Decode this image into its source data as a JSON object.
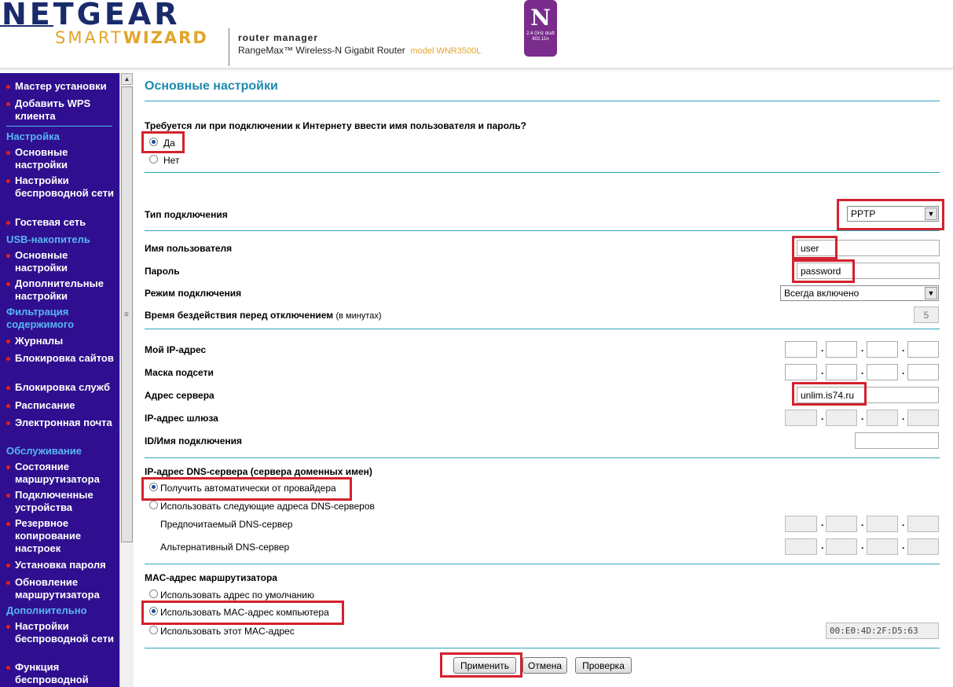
{
  "header": {
    "brand": "NETGEAR",
    "brand_sub_a": "SMART",
    "brand_sub_b": "WIZARD",
    "tagline": "router manager",
    "device": "RangeMax™ Wireless-N Gigabit Router",
    "model": "model WNR3500L",
    "badge_letter": "N",
    "badge_small": "2.4 GHz draft 802.11n"
  },
  "sidebar": {
    "items": [
      {
        "kind": "item",
        "label": "Мастер установки"
      },
      {
        "kind": "item",
        "label": "Добавить WPS клиента"
      },
      {
        "kind": "head",
        "label": "Настройка"
      },
      {
        "kind": "item",
        "label": "Основные настройки"
      },
      {
        "kind": "item",
        "label": "Настройки беспроводной сети"
      },
      {
        "kind": "item",
        "label": "Гостевая сеть"
      },
      {
        "kind": "head",
        "label": "USB-накопитель"
      },
      {
        "kind": "item",
        "label": "Основные настройки"
      },
      {
        "kind": "item",
        "label": "Дополнительные настройки"
      },
      {
        "kind": "head",
        "label": "Фильтрация содержимого"
      },
      {
        "kind": "item",
        "label": "Журналы"
      },
      {
        "kind": "item",
        "label": "Блокировка сайтов"
      },
      {
        "kind": "item",
        "label": "Блокировка служб"
      },
      {
        "kind": "item",
        "label": "Расписание"
      },
      {
        "kind": "item",
        "label": "Электронная почта"
      },
      {
        "kind": "head",
        "label": "Обслуживание"
      },
      {
        "kind": "item",
        "label": "Состояние маршрутизатора"
      },
      {
        "kind": "item",
        "label": "Подключенные устройства"
      },
      {
        "kind": "item",
        "label": "Резервное копирование настроек"
      },
      {
        "kind": "item",
        "label": "Установка пароля"
      },
      {
        "kind": "item",
        "label": "Обновление маршрутизатора"
      },
      {
        "kind": "head",
        "label": "Дополнительно"
      },
      {
        "kind": "item",
        "label": "Настройки беспроводной сети"
      },
      {
        "kind": "item",
        "label": "Функция беспроводной"
      }
    ]
  },
  "main": {
    "title": "Основные настройки",
    "login_question": "Требуется ли при подключении к Интернету ввести имя пользователя и пароль?",
    "login_yes": "Да",
    "login_no": "Нет",
    "conn_type_label": "Тип подключения",
    "conn_type_value": "PPTP",
    "username_label": "Имя пользователя",
    "username_value": "user",
    "password_label": "Пароль",
    "password_value": "password",
    "mode_label": "Режим подключения",
    "mode_value": "Всегда включено",
    "idle_label": "Время бездействия перед отключением",
    "idle_unit": "(в минутах)",
    "idle_value": "5",
    "my_ip_label": "Мой IP-адрес",
    "mask_label": "Маска подсети",
    "server_label": "Адрес сервера",
    "server_value": "unlim.is74.ru",
    "gateway_label": "IP-адрес шлюза",
    "conn_id_label": "ID/Имя подключения",
    "dns_section": "IP-адрес DNS-сервера (сервера доменных имен)",
    "dns_auto": "Получить автоматически от провайдера",
    "dns_manual": "Использовать следующие адреса DNS-серверов",
    "dns_primary": "Предпочитаемый DNS-сервер",
    "dns_secondary": "Альтернативный DNS-сервер",
    "mac_section": "MAC-адрес маршрутизатора",
    "mac_default": "Использовать адрес по умолчанию",
    "mac_computer": "Использовать MAC-адрес компьютера",
    "mac_this": "Использовать этот MAC-адрес",
    "mac_value": "00:E0:4D:2F:D5:63",
    "btn_apply": "Применить",
    "btn_cancel": "Отмена",
    "btn_test": "Проверка"
  },
  "colors": {
    "sidebar_bg": "#2f0f8f",
    "sidebar_head": "#57b6f3",
    "accent_line": "#30a3bc",
    "highlight": "#d4212f"
  }
}
